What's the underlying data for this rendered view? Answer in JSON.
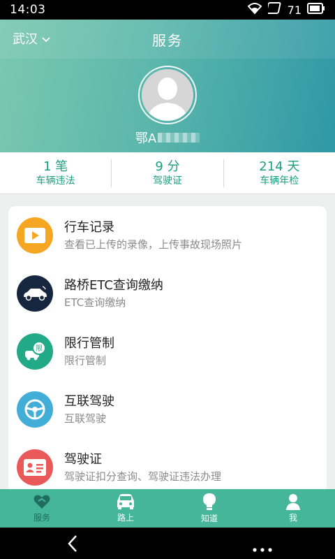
{
  "status_bar": {
    "time": "14:03",
    "battery": "71"
  },
  "header": {
    "city": "武汉",
    "title": "服务",
    "plate": "鄂A"
  },
  "stats": [
    {
      "value": "1 笔",
      "label": "车辆违法"
    },
    {
      "value": "9 分",
      "label": "驾驶证"
    },
    {
      "value": "214 天",
      "label": "车辆年检"
    }
  ],
  "services": [
    {
      "title": "行车记录",
      "subtitle": "查看已上传的录像，上传事故现场照片",
      "icon": "video-icon",
      "color": "#f5a623"
    },
    {
      "title": "路桥ETC查询缴纳",
      "subtitle": "ETC查询缴纳",
      "icon": "car-etc-icon",
      "color": "#17263f"
    },
    {
      "title": "限行管制",
      "subtitle": "限行管制",
      "icon": "restriction-icon",
      "color": "#22a987"
    },
    {
      "title": "互联驾驶",
      "subtitle": "互联驾驶",
      "icon": "steering-wheel-icon",
      "color": "#42aed8"
    },
    {
      "title": "驾驶证",
      "subtitle": "驾驶证扣分查询、驾驶证违法办理",
      "icon": "license-icon",
      "color": "#e9595a"
    }
  ],
  "nav": [
    {
      "label": "服务",
      "icon": "handshake-icon",
      "active": true
    },
    {
      "label": "路上",
      "icon": "car-icon",
      "active": false
    },
    {
      "label": "知道",
      "icon": "bulb-icon",
      "active": false
    },
    {
      "label": "我",
      "icon": "person-icon",
      "active": false
    }
  ]
}
